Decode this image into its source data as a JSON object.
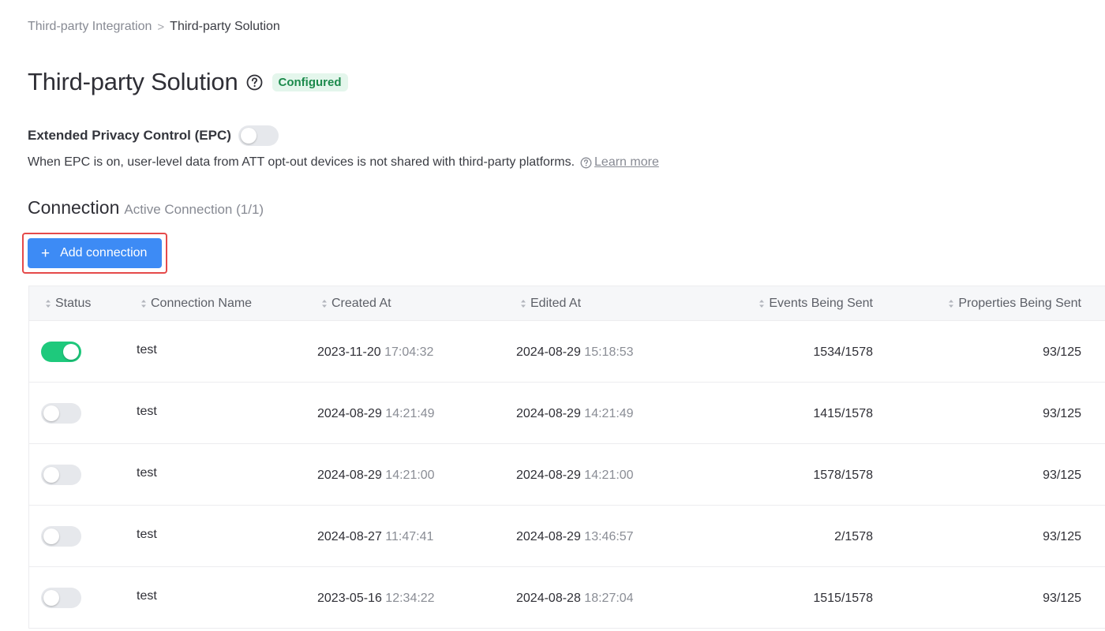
{
  "breadcrumb": {
    "parent": "Third-party Integration",
    "separator": ">",
    "current": "Third-party Solution"
  },
  "header": {
    "title": "Third-party Solution",
    "help_icon": "question-circle-icon",
    "badge": "Configured",
    "badge_color": "#1c8a4c"
  },
  "epc": {
    "label": "Extended Privacy Control (EPC)",
    "enabled": false,
    "description": "When EPC is on, user-level data from ATT opt-out devices is not shared with third-party platforms.",
    "learn_more": "Learn more"
  },
  "connection": {
    "title": "Connection",
    "subtitle": "Active Connection (1/1)",
    "add_button": "Add connection",
    "add_icon": "plus-icon"
  },
  "table": {
    "columns": [
      "Status",
      "Connection Name",
      "Created At",
      "Edited At",
      "Events Being Sent",
      "Properties Being Sent"
    ],
    "rows": [
      {
        "status_on": true,
        "name": "test",
        "created_date": "2023-11-20",
        "created_time": "17:04:32",
        "edited_date": "2024-08-29",
        "edited_time": "15:18:53",
        "events": "1534/1578",
        "properties": "93/125"
      },
      {
        "status_on": false,
        "name": "test",
        "created_date": "2024-08-29",
        "created_time": "14:21:49",
        "edited_date": "2024-08-29",
        "edited_time": "14:21:49",
        "events": "1415/1578",
        "properties": "93/125"
      },
      {
        "status_on": false,
        "name": "test",
        "created_date": "2024-08-29",
        "created_time": "14:21:00",
        "edited_date": "2024-08-29",
        "edited_time": "14:21:00",
        "events": "1578/1578",
        "properties": "93/125"
      },
      {
        "status_on": false,
        "name": "test",
        "created_date": "2024-08-27",
        "created_time": "11:47:41",
        "edited_date": "2024-08-29",
        "edited_time": "13:46:57",
        "events": "2/1578",
        "properties": "93/125"
      },
      {
        "status_on": false,
        "name": "test",
        "created_date": "2023-05-16",
        "created_time": "12:34:22",
        "edited_date": "2024-08-28",
        "edited_time": "18:27:04",
        "events": "1515/1578",
        "properties": "93/125"
      }
    ]
  },
  "colors": {
    "accent": "#3d8bf5",
    "toggle_on": "#1ec97c",
    "highlight_border": "#e54a4a"
  }
}
